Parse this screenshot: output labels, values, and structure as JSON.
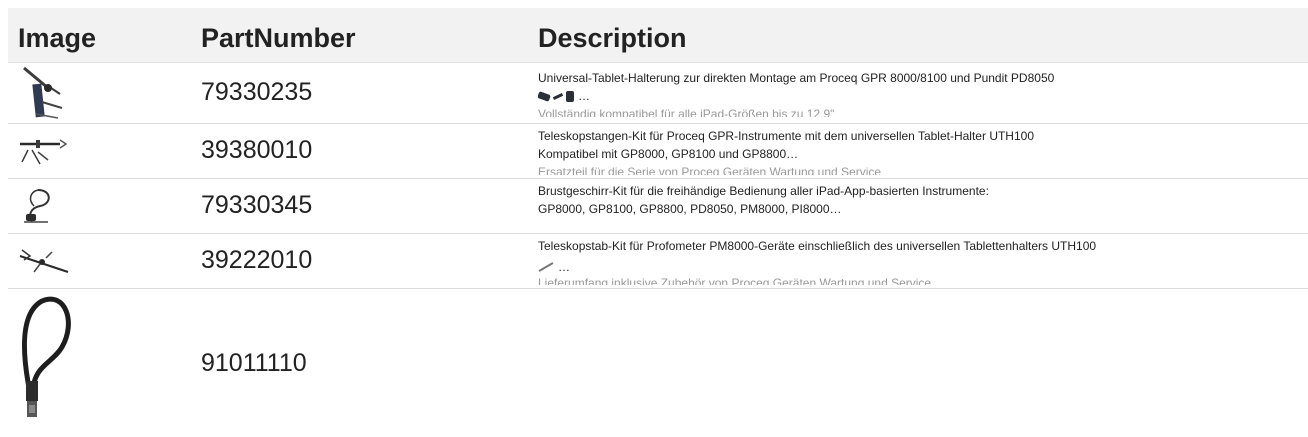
{
  "table": {
    "headers": {
      "image": "Image",
      "part_number": "PartNumber",
      "description": "Description"
    },
    "rows": [
      {
        "image_icon": "tablet-holder-icon",
        "part_number": "79330235",
        "description_line1": "Universal-Tablet-Halterung zur direkten Montage am Proceq GPR 8000/8100 und Pundit PD8050",
        "description_line2": "…",
        "description_line3": "Vollständig kompatibel für alle iPad-Größen bis zu 12,9\""
      },
      {
        "image_icon": "telescopic-pole-kit-icon",
        "part_number": "39380010",
        "description_line1": "Teleskopstangen-Kit für Proceq GPR-Instrumente mit dem universellen Tablet-Halter UTH100",
        "description_line2": "Kompatibel mit GP8000, GP8100 und GP8800…",
        "description_line3": "Ersatzteil für die Serie von Proceq Geräten Wartung und Service"
      },
      {
        "image_icon": "harness-kit-icon",
        "part_number": "79330345",
        "description_line1": "Brustgeschirr-Kit für die freihändige Bedienung aller iPad-App-basierten Instrumente:",
        "description_line2": "GP8000, GP8100, GP8800, PD8050, PM8000, PI8000…"
      },
      {
        "image_icon": "telescopic-rod-kit-icon",
        "part_number": "39222010",
        "description_line1": "Teleskopstab-Kit für Profometer PM8000-Geräte einschließlich des universellen Tablettenhalters UTH100",
        "description_line2": "…",
        "description_line3": "Lieferumfang inklusive Zubehör von Proceq Geräten Wartung und Service"
      },
      {
        "image_icon": "cable-lock-icon",
        "part_number": "91011110",
        "description_line1": ""
      }
    ]
  }
}
